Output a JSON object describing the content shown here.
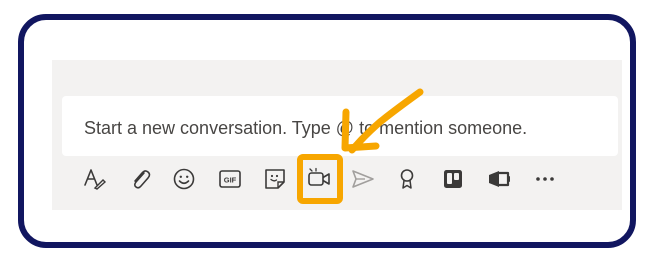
{
  "compose": {
    "placeholder": "Start a new conversation. Type @ to mention someone."
  },
  "toolbar": {
    "items": [
      {
        "name": "format",
        "icon": "format-icon"
      },
      {
        "name": "attach",
        "icon": "paperclip-icon"
      },
      {
        "name": "emoji",
        "icon": "smiley-icon"
      },
      {
        "name": "gif",
        "icon": "gif-icon",
        "label": "GIF"
      },
      {
        "name": "sticker",
        "icon": "sticker-icon"
      },
      {
        "name": "meet-now",
        "icon": "video-camera-icon"
      },
      {
        "name": "send",
        "icon": "send-icon"
      },
      {
        "name": "praise",
        "icon": "praise-icon"
      },
      {
        "name": "trello",
        "icon": "trello-icon"
      },
      {
        "name": "stream",
        "icon": "stream-icon"
      },
      {
        "name": "more",
        "icon": "more-options-icon",
        "label": "•••"
      }
    ]
  },
  "annotation": {
    "color": "#f7a600"
  },
  "colors": {
    "frame": "#111660",
    "accent": "#f7a600",
    "panel": "#f3f2f1"
  }
}
